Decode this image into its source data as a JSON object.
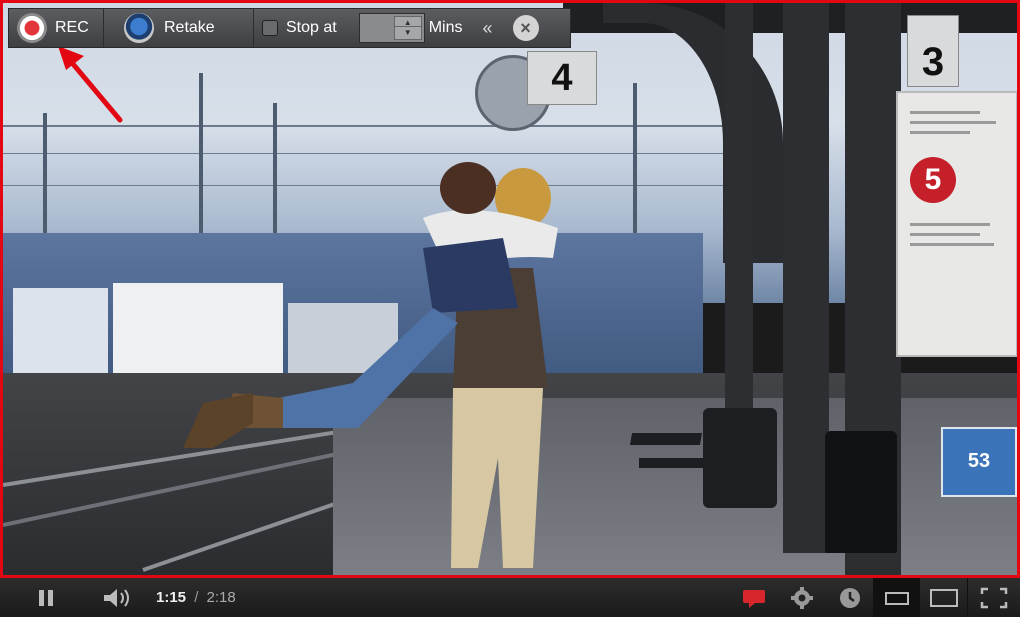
{
  "recorder_toolbar": {
    "rec_label": "REC",
    "retake_label": "Retake",
    "stop_at_label": "Stop at",
    "stop_at_checked": false,
    "mins_value": "",
    "mins_label": "Mins",
    "collapse_glyph": "«",
    "close_glyph": "×",
    "icons": [
      "record-icon",
      "retake-icon",
      "checkbox",
      "spinner-up-icon",
      "spinner-down-icon",
      "collapse-icon",
      "close-icon"
    ]
  },
  "video_scene": {
    "track_signs": [
      "4",
      "3"
    ],
    "platform_sign_number": "5",
    "station_sign_number": "53"
  },
  "player_controls": {
    "time_current": "1:15",
    "time_separator": "/",
    "time_total": "2:18",
    "icons": [
      "pause-icon",
      "volume-icon",
      "captions-icon",
      "settings-icon",
      "watch-later-icon",
      "small-player-icon",
      "large-player-icon",
      "fullscreen-icon"
    ]
  },
  "colors": {
    "capture_frame": "#e30613",
    "annotation_arrow": "#e30613",
    "captions_icon": "#d8262d"
  }
}
